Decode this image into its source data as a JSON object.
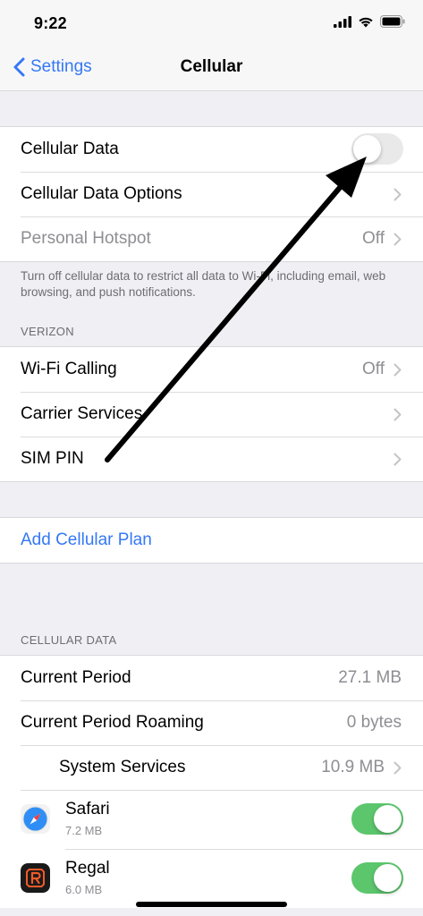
{
  "status": {
    "time": "9:22"
  },
  "nav": {
    "back_label": "Settings",
    "title": "Cellular"
  },
  "group1": {
    "cellular_data": {
      "label": "Cellular Data",
      "enabled": false
    },
    "cellular_data_options": {
      "label": "Cellular Data Options"
    },
    "personal_hotspot": {
      "label": "Personal Hotspot",
      "value": "Off"
    }
  },
  "group1_footer": "Turn off cellular data to restrict all data to Wi-Fi, including email, web browsing, and push notifications.",
  "carrier_header": "VERIZON",
  "carrier": {
    "wifi_calling": {
      "label": "Wi-Fi Calling",
      "value": "Off"
    },
    "carrier_services": {
      "label": "Carrier Services"
    },
    "sim_pin": {
      "label": "SIM PIN"
    }
  },
  "add_plan": {
    "label": "Add Cellular Plan"
  },
  "usage_header": "CELLULAR DATA",
  "usage": {
    "current_period": {
      "label": "Current Period",
      "value": "27.1 MB"
    },
    "current_period_roaming": {
      "label": "Current Period Roaming",
      "value": "0 bytes"
    },
    "system_services": {
      "label": "System Services",
      "value": "10.9 MB"
    }
  },
  "apps": [
    {
      "name": "Safari",
      "size": "7.2 MB",
      "enabled": true,
      "icon": "safari-compass-icon"
    },
    {
      "name": "Regal",
      "size": "6.0 MB",
      "enabled": true,
      "icon": "regal-logo-icon"
    }
  ],
  "colors": {
    "accent": "#3478f6",
    "toggle_on": "#5cc66d",
    "toggle_off": "#e9e9ea",
    "background": "#efeff4"
  }
}
